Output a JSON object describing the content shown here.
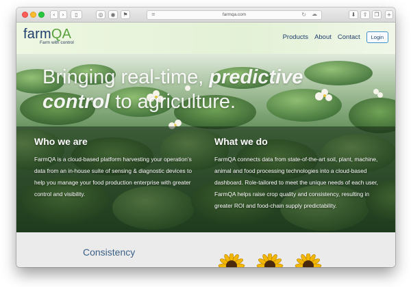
{
  "browser": {
    "url": "farmqa.com"
  },
  "header": {
    "logo": {
      "farm": "farm",
      "qa": "QA",
      "tagline": "Farm with control"
    },
    "nav": [
      "Products",
      "About",
      "Contact"
    ],
    "login_label": "Login"
  },
  "hero": {
    "headline_prefix": "Bringing real-time, ",
    "headline_emphasis": "predictive control",
    "headline_suffix": " to agriculture.",
    "who": {
      "title": "Who we are",
      "body": "FarmQA is a cloud-based platform harvesting your operation’s data from an in-house suite of sensing & diagnostic devices to help you manage your food production enterprise with greater control and visibility."
    },
    "what": {
      "title": "What we do",
      "body": "FarmQA connects data from state-of-the-art soil, plant, machine, animal and food processing technologies into a cloud-based dashboard.  Role-tailored to meet the unique needs of each user, FarmQA helps raise crop quality and consistency, resulting in greater ROI and food-chain supply predictability."
    }
  },
  "section": {
    "title": "Consistency"
  },
  "colors": {
    "brand_blue": "#1f3e6b",
    "brand_green": "#5aa13c",
    "lower_background": "#ebebeb"
  },
  "icons": [
    "back-icon",
    "forward-icon",
    "sidebar-icon",
    "privacy-icon",
    "extension-icon",
    "flag-icon",
    "reader-icon",
    "reload-icon",
    "cloud-icon",
    "download-icon",
    "share-icon",
    "tabs-icon",
    "new-tab-icon"
  ]
}
